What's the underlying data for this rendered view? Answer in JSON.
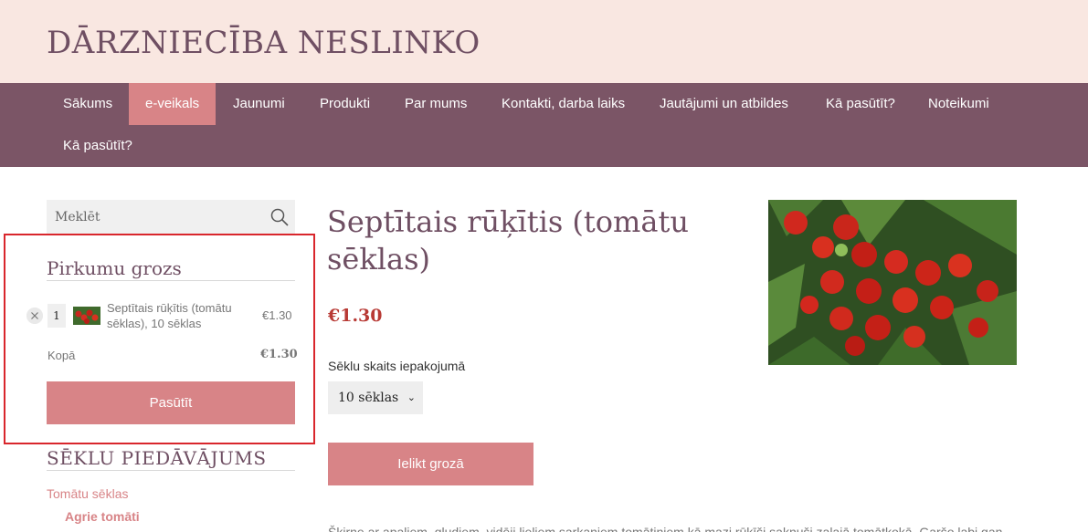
{
  "site": {
    "title": "DĀRZNIECĪBA NESLINKO"
  },
  "nav": {
    "items": [
      "Sākums",
      "e-veikals",
      "Jaunumi",
      "Produkti",
      "Par mums",
      "Kontakti, darba laiks",
      "Jautājumi un atbildes",
      "Kā pasūtīt?",
      "Noteikumi",
      "Kā pasūtīt?"
    ],
    "active": "e-veikals"
  },
  "search": {
    "placeholder": "Meklēt"
  },
  "cart": {
    "title": "Pirkumu grozs",
    "item": {
      "qty": "1",
      "name": "Septītais rūķītis (tomātu sēklas), 10 sēklas",
      "price": "€1.30"
    },
    "total_label": "Kopā",
    "total_value": "€1.30",
    "checkout_label": "Pasūtīt"
  },
  "sidebar": {
    "offer_title": "SĒKLU PIEDĀVĀJUMS",
    "category": "Tomātu sēklas",
    "subcategory": "Agrie tomāti"
  },
  "product": {
    "title": "Septītais rūķītis (tomātu sēklas)",
    "price": "€1.30",
    "variant_label": "Sēklu skaits iepakojumā",
    "variant_selected": "10 sēklas",
    "add_to_cart_label": "Ielikt grozā",
    "description": "Šķirne ar apaļiem, gludiem, vidēji lieliem sarkaniem tomātiņiem kā mazi rūķīši sakņuši zaļajā tomātkokā. Garšo labi gan"
  },
  "colors": {
    "header_bg": "#f9e7e1",
    "nav_bg": "#7b5566",
    "accent": "#d88487",
    "title": "#6f4f63",
    "price": "#b83a35",
    "highlight_border": "#d9262c"
  },
  "icons": {
    "search": "search-icon",
    "remove": "close-icon",
    "dropdown": "chevron-down-icon"
  }
}
